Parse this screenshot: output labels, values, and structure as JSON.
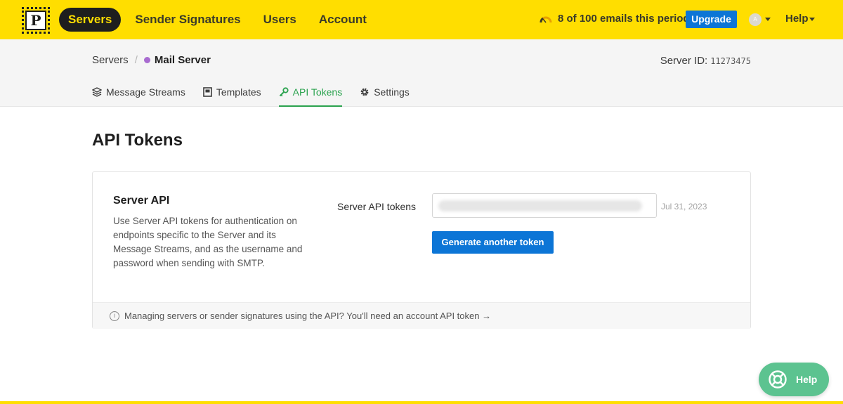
{
  "app": {
    "logo_letter": "P"
  },
  "nav": {
    "items": [
      {
        "label": "Servers",
        "active": true
      },
      {
        "label": "Sender Signatures"
      },
      {
        "label": "Users"
      },
      {
        "label": "Account"
      }
    ]
  },
  "usage": {
    "text": "8 of 100 emails this period"
  },
  "upgrade_label": "Upgrade",
  "avatar_initial": "A",
  "help_menu_label": "Help",
  "breadcrumb": {
    "root": "Servers",
    "separator": "/",
    "current": "Mail Server"
  },
  "server_id": {
    "label": "Server ID:",
    "value": "11273475"
  },
  "tabs": [
    {
      "label": "Message Streams",
      "icon": "layers-icon"
    },
    {
      "label": "Templates",
      "icon": "template-icon"
    },
    {
      "label": "API Tokens",
      "icon": "key-icon",
      "active": true
    },
    {
      "label": "Settings",
      "icon": "gear-icon"
    }
  ],
  "page_title": "API Tokens",
  "card": {
    "title": "Server API",
    "description": "Use Server API tokens for authentication on endpoints specific to the Server and its Message Streams, and as the username and password when sending with SMTP.",
    "token_label": "Server API tokens",
    "token_date": "Jul 31, 2023",
    "generate_label": "Generate another token",
    "footer_text": "Managing servers or sender signatures using the API? You'll need an account API token →"
  },
  "help_fab_label": "Help",
  "colors": {
    "brand_yellow": "#ffde00",
    "primary_blue": "#0c75d6",
    "active_green": "#2aa24e",
    "help_green": "#5cc390",
    "server_dot": "#a86bd0"
  }
}
